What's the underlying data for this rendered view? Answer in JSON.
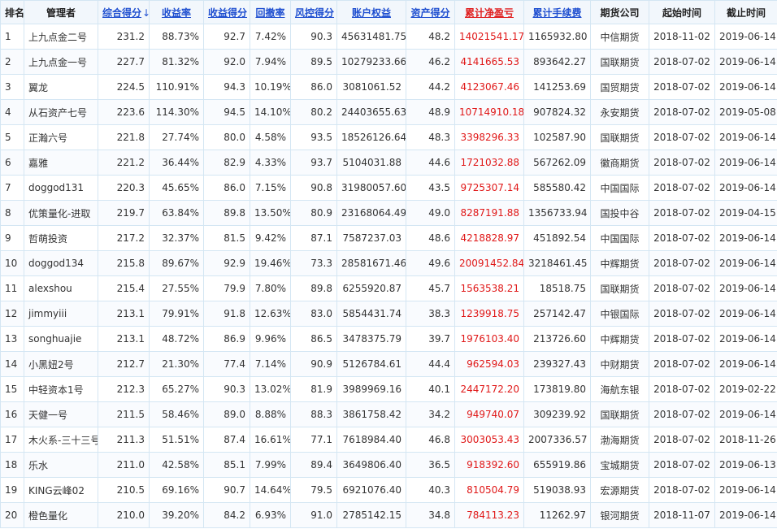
{
  "headers": {
    "rank": "排名",
    "manager": "管理者",
    "score": "综合得分",
    "score_sort": "↓",
    "return_rate": "收益率",
    "return_score": "收益得分",
    "drawdown": "回撤率",
    "risk_score": "风控得分",
    "equity": "账户权益",
    "asset_score": "资产得分",
    "net_profit": "累计净盈亏",
    "fees": "累计手续费",
    "broker": "期货公司",
    "start": "起始时间",
    "end": "截止时间"
  },
  "rows": [
    {
      "rank": "1",
      "manager": "上九点金二号",
      "score": "231.2",
      "return_rate": "88.73%",
      "return_score": "92.7",
      "drawdown": "7.42%",
      "risk_score": "90.3",
      "equity": "45631481.75",
      "asset_score": "48.2",
      "net_profit": "14021541.17",
      "fees": "1165932.80",
      "broker": "中信期货",
      "start": "2018-11-02",
      "end": "2019-06-14"
    },
    {
      "rank": "2",
      "manager": "上九点金一号",
      "score": "227.7",
      "return_rate": "81.32%",
      "return_score": "92.0",
      "drawdown": "7.94%",
      "risk_score": "89.5",
      "equity": "10279233.66",
      "asset_score": "46.2",
      "net_profit": "4141665.53",
      "fees": "893642.27",
      "broker": "国联期货",
      "start": "2018-07-02",
      "end": "2019-06-14"
    },
    {
      "rank": "3",
      "manager": "翼龙",
      "score": "224.5",
      "return_rate": "110.91%",
      "return_score": "94.3",
      "drawdown": "10.19%",
      "risk_score": "86.0",
      "equity": "3081061.52",
      "asset_score": "44.2",
      "net_profit": "4123067.46",
      "fees": "141253.69",
      "broker": "国贸期货",
      "start": "2018-07-02",
      "end": "2019-06-14"
    },
    {
      "rank": "4",
      "manager": "从石资产七号",
      "score": "223.6",
      "return_rate": "114.30%",
      "return_score": "94.5",
      "drawdown": "14.10%",
      "risk_score": "80.2",
      "equity": "24403655.63",
      "asset_score": "48.9",
      "net_profit": "10714910.18",
      "fees": "907824.32",
      "broker": "永安期货",
      "start": "2018-07-02",
      "end": "2019-05-08"
    },
    {
      "rank": "5",
      "manager": "正瀚六号",
      "score": "221.8",
      "return_rate": "27.74%",
      "return_score": "80.0",
      "drawdown": "4.58%",
      "risk_score": "93.5",
      "equity": "18526126.64",
      "asset_score": "48.3",
      "net_profit": "3398296.33",
      "fees": "102587.90",
      "broker": "国联期货",
      "start": "2018-07-02",
      "end": "2019-06-14"
    },
    {
      "rank": "6",
      "manager": "嘉雅",
      "score": "221.2",
      "return_rate": "36.44%",
      "return_score": "82.9",
      "drawdown": "4.33%",
      "risk_score": "93.7",
      "equity": "5104031.88",
      "asset_score": "44.6",
      "net_profit": "1721032.88",
      "fees": "567262.09",
      "broker": "徽商期货",
      "start": "2018-07-02",
      "end": "2019-06-14"
    },
    {
      "rank": "7",
      "manager": "doggod131",
      "score": "220.3",
      "return_rate": "45.65%",
      "return_score": "86.0",
      "drawdown": "7.15%",
      "risk_score": "90.8",
      "equity": "31980057.60",
      "asset_score": "43.5",
      "net_profit": "9725307.14",
      "fees": "585580.42",
      "broker": "中国国际",
      "start": "2018-07-02",
      "end": "2019-06-14"
    },
    {
      "rank": "8",
      "manager": "优策量化-进取",
      "score": "219.7",
      "return_rate": "63.84%",
      "return_score": "89.8",
      "drawdown": "13.50%",
      "risk_score": "80.9",
      "equity": "23168064.49",
      "asset_score": "49.0",
      "net_profit": "8287191.88",
      "fees": "1356733.94",
      "broker": "国投中谷",
      "start": "2018-07-02",
      "end": "2019-04-15"
    },
    {
      "rank": "9",
      "manager": "哲萌投资",
      "score": "217.2",
      "return_rate": "32.37%",
      "return_score": "81.5",
      "drawdown": "9.42%",
      "risk_score": "87.1",
      "equity": "7587237.03",
      "asset_score": "48.6",
      "net_profit": "4218828.97",
      "fees": "451892.54",
      "broker": "中国国际",
      "start": "2018-07-02",
      "end": "2019-06-14"
    },
    {
      "rank": "10",
      "manager": "doggod134",
      "score": "215.8",
      "return_rate": "89.67%",
      "return_score": "92.9",
      "drawdown": "19.46%",
      "risk_score": "73.3",
      "equity": "28581671.46",
      "asset_score": "49.6",
      "net_profit": "20091452.84",
      "fees": "3218461.45",
      "broker": "中辉期货",
      "start": "2018-07-02",
      "end": "2019-06-14"
    },
    {
      "rank": "11",
      "manager": "alexshou",
      "score": "215.4",
      "return_rate": "27.55%",
      "return_score": "79.9",
      "drawdown": "7.80%",
      "risk_score": "89.8",
      "equity": "6255920.87",
      "asset_score": "45.7",
      "net_profit": "1563538.21",
      "fees": "18518.75",
      "broker": "国联期货",
      "start": "2018-07-02",
      "end": "2019-06-14"
    },
    {
      "rank": "12",
      "manager": "jimmyiii",
      "score": "213.1",
      "return_rate": "79.91%",
      "return_score": "91.8",
      "drawdown": "12.63%",
      "risk_score": "83.0",
      "equity": "5854431.74",
      "asset_score": "38.3",
      "net_profit": "1239918.75",
      "fees": "257142.47",
      "broker": "中银国际",
      "start": "2018-07-02",
      "end": "2019-06-14"
    },
    {
      "rank": "13",
      "manager": "songhuajie",
      "score": "213.1",
      "return_rate": "48.72%",
      "return_score": "86.9",
      "drawdown": "9.96%",
      "risk_score": "86.5",
      "equity": "3478375.79",
      "asset_score": "39.7",
      "net_profit": "1976103.40",
      "fees": "213726.60",
      "broker": "中辉期货",
      "start": "2018-07-02",
      "end": "2019-06-14"
    },
    {
      "rank": "14",
      "manager": "小黑妞2号",
      "score": "212.7",
      "return_rate": "21.30%",
      "return_score": "77.4",
      "drawdown": "7.14%",
      "risk_score": "90.9",
      "equity": "5126784.61",
      "asset_score": "44.4",
      "net_profit": "962594.03",
      "fees": "239327.43",
      "broker": "中财期货",
      "start": "2018-07-02",
      "end": "2019-06-14"
    },
    {
      "rank": "15",
      "manager": "中轻资本1号",
      "score": "212.3",
      "return_rate": "65.27%",
      "return_score": "90.3",
      "drawdown": "13.02%",
      "risk_score": "81.9",
      "equity": "3989969.16",
      "asset_score": "40.1",
      "net_profit": "2447172.20",
      "fees": "173819.80",
      "broker": "海航东银",
      "start": "2018-07-02",
      "end": "2019-02-22"
    },
    {
      "rank": "16",
      "manager": "天健一号",
      "score": "211.5",
      "return_rate": "58.46%",
      "return_score": "89.0",
      "drawdown": "8.88%",
      "risk_score": "88.3",
      "equity": "3861758.42",
      "asset_score": "34.2",
      "net_profit": "949740.07",
      "fees": "309239.92",
      "broker": "国联期货",
      "start": "2018-07-02",
      "end": "2019-06-14"
    },
    {
      "rank": "17",
      "manager": "木火系-三十三号",
      "score": "211.3",
      "return_rate": "51.51%",
      "return_score": "87.4",
      "drawdown": "16.61%",
      "risk_score": "77.1",
      "equity": "7618984.40",
      "asset_score": "46.8",
      "net_profit": "3003053.43",
      "fees": "2007336.57",
      "broker": "渤海期货",
      "start": "2018-07-02",
      "end": "2018-11-26"
    },
    {
      "rank": "18",
      "manager": "乐水",
      "score": "211.0",
      "return_rate": "42.58%",
      "return_score": "85.1",
      "drawdown": "7.99%",
      "risk_score": "89.4",
      "equity": "3649806.40",
      "asset_score": "36.5",
      "net_profit": "918392.60",
      "fees": "655919.86",
      "broker": "宝城期货",
      "start": "2018-07-02",
      "end": "2019-06-13"
    },
    {
      "rank": "19",
      "manager": "KING云峰02",
      "score": "210.5",
      "return_rate": "69.16%",
      "return_score": "90.7",
      "drawdown": "14.64%",
      "risk_score": "79.5",
      "equity": "6921076.40",
      "asset_score": "40.3",
      "net_profit": "810504.79",
      "fees": "519038.93",
      "broker": "宏源期货",
      "start": "2018-07-02",
      "end": "2019-06-14"
    },
    {
      "rank": "20",
      "manager": "橙色量化",
      "score": "210.0",
      "return_rate": "39.20%",
      "return_score": "84.2",
      "drawdown": "6.93%",
      "risk_score": "91.0",
      "equity": "2785142.15",
      "asset_score": "34.8",
      "net_profit": "784113.23",
      "fees": "11262.97",
      "broker": "银河期货",
      "start": "2018-11-07",
      "end": "2019-06-14"
    }
  ]
}
